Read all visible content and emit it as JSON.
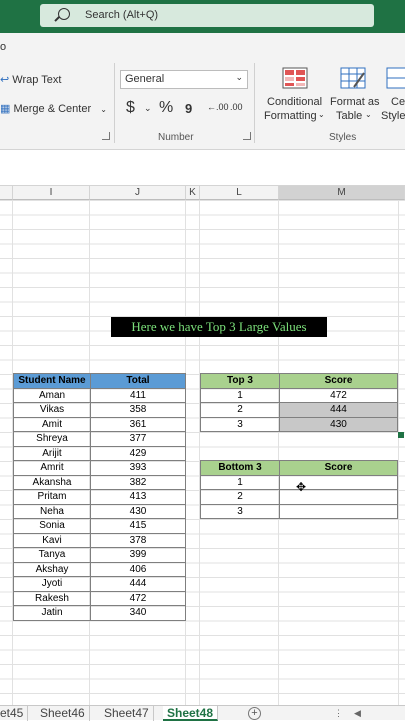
{
  "search": {
    "placeholder": "Search (Alt+Q)"
  },
  "ribbon": {
    "menu_fragment": "o",
    "alignment": {
      "wrap_text": "Wrap Text",
      "merge_center": "Merge & Center"
    },
    "number": {
      "format_value": "General",
      "currency": "$",
      "percent": "%",
      "comma": "9",
      "inc_decimal": ".00",
      "dec_decimal": ".00",
      "group_label": "Number"
    },
    "styles": {
      "conditional_formatting_1": "Conditional",
      "conditional_formatting_2": "Formatting",
      "format_table_1": "Format as",
      "format_table_2": "Table",
      "cell_styles_1": "Cell",
      "cell_styles_2": "Styles",
      "group_label": "Styles"
    }
  },
  "columns": [
    "I",
    "J",
    "K",
    "L",
    "M"
  ],
  "banner": "Here we have Top 3 Large Values",
  "student_table": {
    "headers": [
      "Student Name",
      "Total"
    ],
    "rows": [
      [
        "Aman",
        "411"
      ],
      [
        "Vikas",
        "358"
      ],
      [
        "Amit",
        "361"
      ],
      [
        "Shreya",
        "377"
      ],
      [
        "Arijit",
        "429"
      ],
      [
        "Amrit",
        "393"
      ],
      [
        "Akansha",
        "382"
      ],
      [
        "Pritam",
        "413"
      ],
      [
        "Neha",
        "430"
      ],
      [
        "Sonia",
        "415"
      ],
      [
        "Kavi",
        "378"
      ],
      [
        "Tanya",
        "399"
      ],
      [
        "Akshay",
        "406"
      ],
      [
        "Jyoti",
        "444"
      ],
      [
        "Rakesh",
        "472"
      ],
      [
        "Jatin",
        "340"
      ]
    ]
  },
  "top_table": {
    "headers": [
      "Top 3",
      "Score"
    ],
    "rows": [
      [
        "1",
        "472"
      ],
      [
        "2",
        "444"
      ],
      [
        "3",
        "430"
      ]
    ]
  },
  "bottom_table": {
    "headers": [
      "Bottom 3",
      "Score"
    ],
    "rows": [
      [
        "1",
        ""
      ],
      [
        "2",
        ""
      ],
      [
        "3",
        ""
      ]
    ]
  },
  "sheets": [
    "et45",
    "Sheet46",
    "Sheet47",
    "Sheet48"
  ],
  "active_sheet": "Sheet48",
  "colors": {
    "excel_green": "#1f7244",
    "blue_header": "#5b9bd5",
    "green_header": "#a9d18e",
    "banner_text": "#7be07a"
  }
}
